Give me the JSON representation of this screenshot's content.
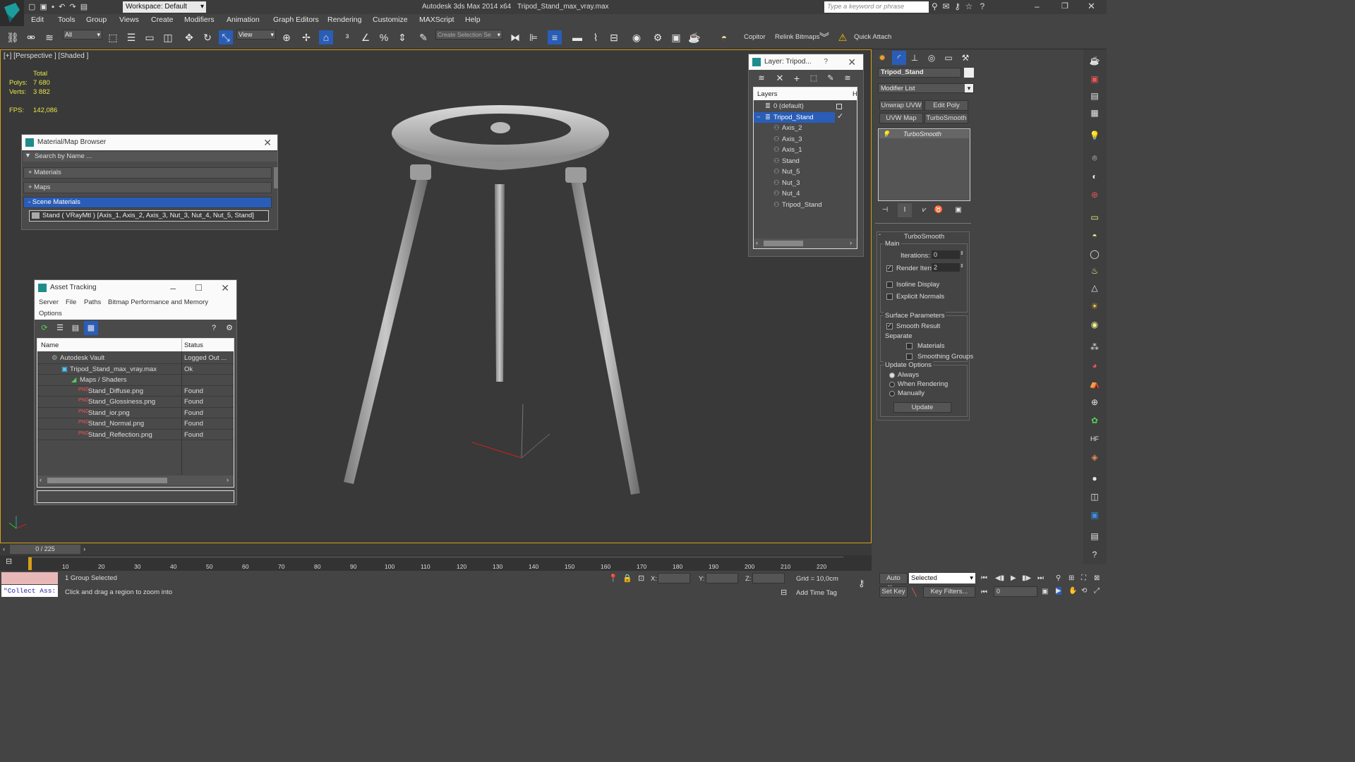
{
  "window": {
    "workspace": "Workspace: Default",
    "app_title": "Autodesk 3ds Max  2014 x64",
    "file_title": "Tripod_Stand_max_vray.max",
    "search_placeholder": "Type a keyword or phrase"
  },
  "menu": [
    "Edit",
    "Tools",
    "Group",
    "Views",
    "Create",
    "Modifiers",
    "Animation",
    "Graph Editors",
    "Rendering",
    "Customize",
    "MAXScript",
    "Help"
  ],
  "toolbar": {
    "selection_filter": "All",
    "ref_coord": "View",
    "selection_set_placeholder": "Create Selection Se",
    "copitor": "Copitor",
    "relink_bitmaps": "Relink Bitmaps",
    "quick_attach": "Quick Attach"
  },
  "viewport": {
    "label": "[+] [Perspective ] [Shaded ]",
    "stats_total": "Total",
    "polys_label": "Polys:",
    "polys_value": "7 680",
    "verts_label": "Verts:",
    "verts_value": "3 882",
    "fps_label": "FPS:",
    "fps_value": "142,086"
  },
  "material_browser": {
    "title": "Material/Map Browser",
    "search_placeholder": "Search by Name ...",
    "groups": [
      "+ Materials",
      "+ Maps",
      "- Scene Materials"
    ],
    "scene_item": "Stand  ( VRayMtl ) [Axis_1, Axis_2, Axis_3, Nut_3, Nut_4, Nut_5, Stand]"
  },
  "asset_tracking": {
    "title": "Asset Tracking",
    "menu": [
      "Server",
      "File",
      "Paths",
      "Bitmap Performance and Memory",
      "Options"
    ],
    "col_name": "Name",
    "col_status": "Status",
    "rows": [
      {
        "name": "Autodesk Vault",
        "status": "Logged Out ..."
      },
      {
        "name": "Tripod_Stand_max_vray.max",
        "status": "Ok"
      },
      {
        "name": "Maps / Shaders",
        "status": ""
      },
      {
        "name": "Stand_Diffuse.png",
        "status": "Found"
      },
      {
        "name": "Stand_Glossiness.png",
        "status": "Found"
      },
      {
        "name": "Stand_ior.png",
        "status": "Found"
      },
      {
        "name": "Stand_Normal.png",
        "status": "Found"
      },
      {
        "name": "Stand_Reflection.png",
        "status": "Found"
      }
    ]
  },
  "layer_panel": {
    "title": "Layer: Tripod...",
    "help": "?",
    "col_layers": "Layers",
    "col_h": "H",
    "items": [
      "0 (default)",
      "Tripod_Stand",
      "Axis_2",
      "Axis_3",
      "Axis_1",
      "Stand",
      "Nut_5",
      "Nut_3",
      "Nut_4",
      "Tripod_Stand"
    ]
  },
  "command_panel": {
    "object_name": "Tripod_Stand",
    "modifier_list": "Modifier List",
    "btn_unwrap": "Unwrap UVW",
    "btn_editpoly": "Edit Poly",
    "btn_uvwmap": "UVW Map",
    "btn_turbosmooth": "TurboSmooth",
    "stack_item": "TurboSmooth",
    "rollout_title": "TurboSmooth",
    "main": "Main",
    "iterations_label": "Iterations:",
    "iterations_value": "0",
    "render_iters_label": "Render Iters:",
    "render_iters_value": "2",
    "isoline": "Isoline Display",
    "explicit": "Explicit Normals",
    "surface_params": "Surface Parameters",
    "smooth_result": "Smooth Result",
    "separate": "Separate",
    "materials": "Materials",
    "smoothing_groups": "Smoothing Groups",
    "update_options": "Update Options",
    "always": "Always",
    "when_rendering": "When Rendering",
    "manually": "Manually",
    "update_btn": "Update"
  },
  "timeline": {
    "frame": "0 / 225",
    "ticks": [
      "10",
      "20",
      "30",
      "40",
      "50",
      "60",
      "70",
      "80",
      "90",
      "100",
      "110",
      "120",
      "130",
      "140",
      "150",
      "160",
      "170",
      "180",
      "190",
      "200",
      "210",
      "220"
    ]
  },
  "status": {
    "maxscript": "\"Collect Ass:",
    "selection": "1 Group Selected",
    "prompt": "Click and drag a region to zoom into",
    "x": "X:",
    "y": "Y:",
    "z": "Z:",
    "grid": "Grid = 10,0cm",
    "add_time_tag": "Add Time Tag",
    "auto_key": "Auto Key",
    "set_key": "Set Key",
    "selected": "Selected",
    "key_filters": "Key Filters...",
    "frame_value": "0"
  }
}
